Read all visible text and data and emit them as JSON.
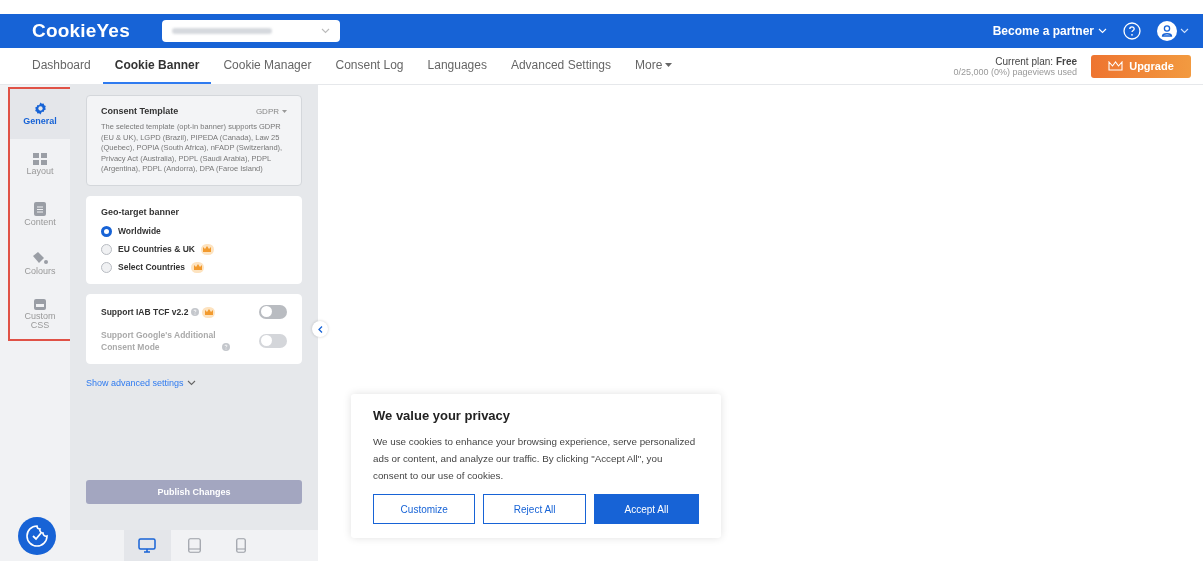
{
  "header": {
    "logo": "CookieYes",
    "partner_link": "Become a partner"
  },
  "nav": [
    {
      "label": "Dashboard",
      "selected": false,
      "dropdown": false
    },
    {
      "label": "Cookie Banner",
      "selected": true,
      "dropdown": false
    },
    {
      "label": "Cookie Manager",
      "selected": false,
      "dropdown": false
    },
    {
      "label": "Consent Log",
      "selected": false,
      "dropdown": false
    },
    {
      "label": "Languages",
      "selected": false,
      "dropdown": false
    },
    {
      "label": "Advanced Settings",
      "selected": false,
      "dropdown": false
    },
    {
      "label": "More",
      "selected": false,
      "dropdown": true
    }
  ],
  "plan": {
    "label": "Current plan: **Free**",
    "usage": "0/25,000 (0%) pageviews used",
    "upgrade": "Upgrade"
  },
  "sidebar": {
    "highlighted": true,
    "items": [
      {
        "kind": "gear",
        "label": "General",
        "selected": true
      },
      {
        "kind": "grid",
        "label": "Layout",
        "selected": false
      },
      {
        "kind": "doc",
        "label": "Content",
        "selected": false
      },
      {
        "kind": "paint",
        "label": "Colours",
        "selected": false
      },
      {
        "kind": "css",
        "label": "Custom CSS",
        "selected": false
      }
    ]
  },
  "template": {
    "title": "Consent Template",
    "selector": "GDPR",
    "description": "The selected template (opt-in banner) supports GDPR (EU & UK), LGPD (Brazil), PIPEDA (Canada), Law 25 (Quebec), POPIA (South Africa), nFADP (Switzerland), Privacy Act (Australia), PDPL (Saudi Arabia), PDPL (Argentina), PDPL (Andorra), DPA (Faroe Island)"
  },
  "geo": {
    "title": "Geo-target banner",
    "options": [
      {
        "label": "Worldwide",
        "selected": true,
        "premium": false
      },
      {
        "label": "EU Countries & UK",
        "selected": false,
        "premium": true
      },
      {
        "label": "Select Countries",
        "selected": false,
        "premium": true
      }
    ]
  },
  "toggles": [
    {
      "label": "Support IAB TCF v2.2",
      "on": false,
      "disabled": false,
      "premium": true
    },
    {
      "label": "Support Google's Additional Consent Mode",
      "on": false,
      "disabled": true,
      "premium": false
    }
  ],
  "advanced_link": "Show advanced settings",
  "publish": {
    "label": "Publish Changes",
    "disabled": true
  },
  "devices": [
    {
      "kind": "desktop",
      "selected": true
    },
    {
      "kind": "tablet",
      "selected": false
    },
    {
      "kind": "mobile",
      "selected": false
    }
  ],
  "banner": {
    "title": "We value your privacy",
    "text": "We use cookies to enhance your browsing experience, serve personalized ads or content, and analyze our traffic. By clicking \"Accept All\", you consent to our use of cookies.",
    "buttons": [
      {
        "label": "Customize",
        "kind": "outline"
      },
      {
        "label": "Reject All",
        "kind": "outline"
      },
      {
        "label": "Accept All",
        "kind": "primary"
      }
    ]
  }
}
